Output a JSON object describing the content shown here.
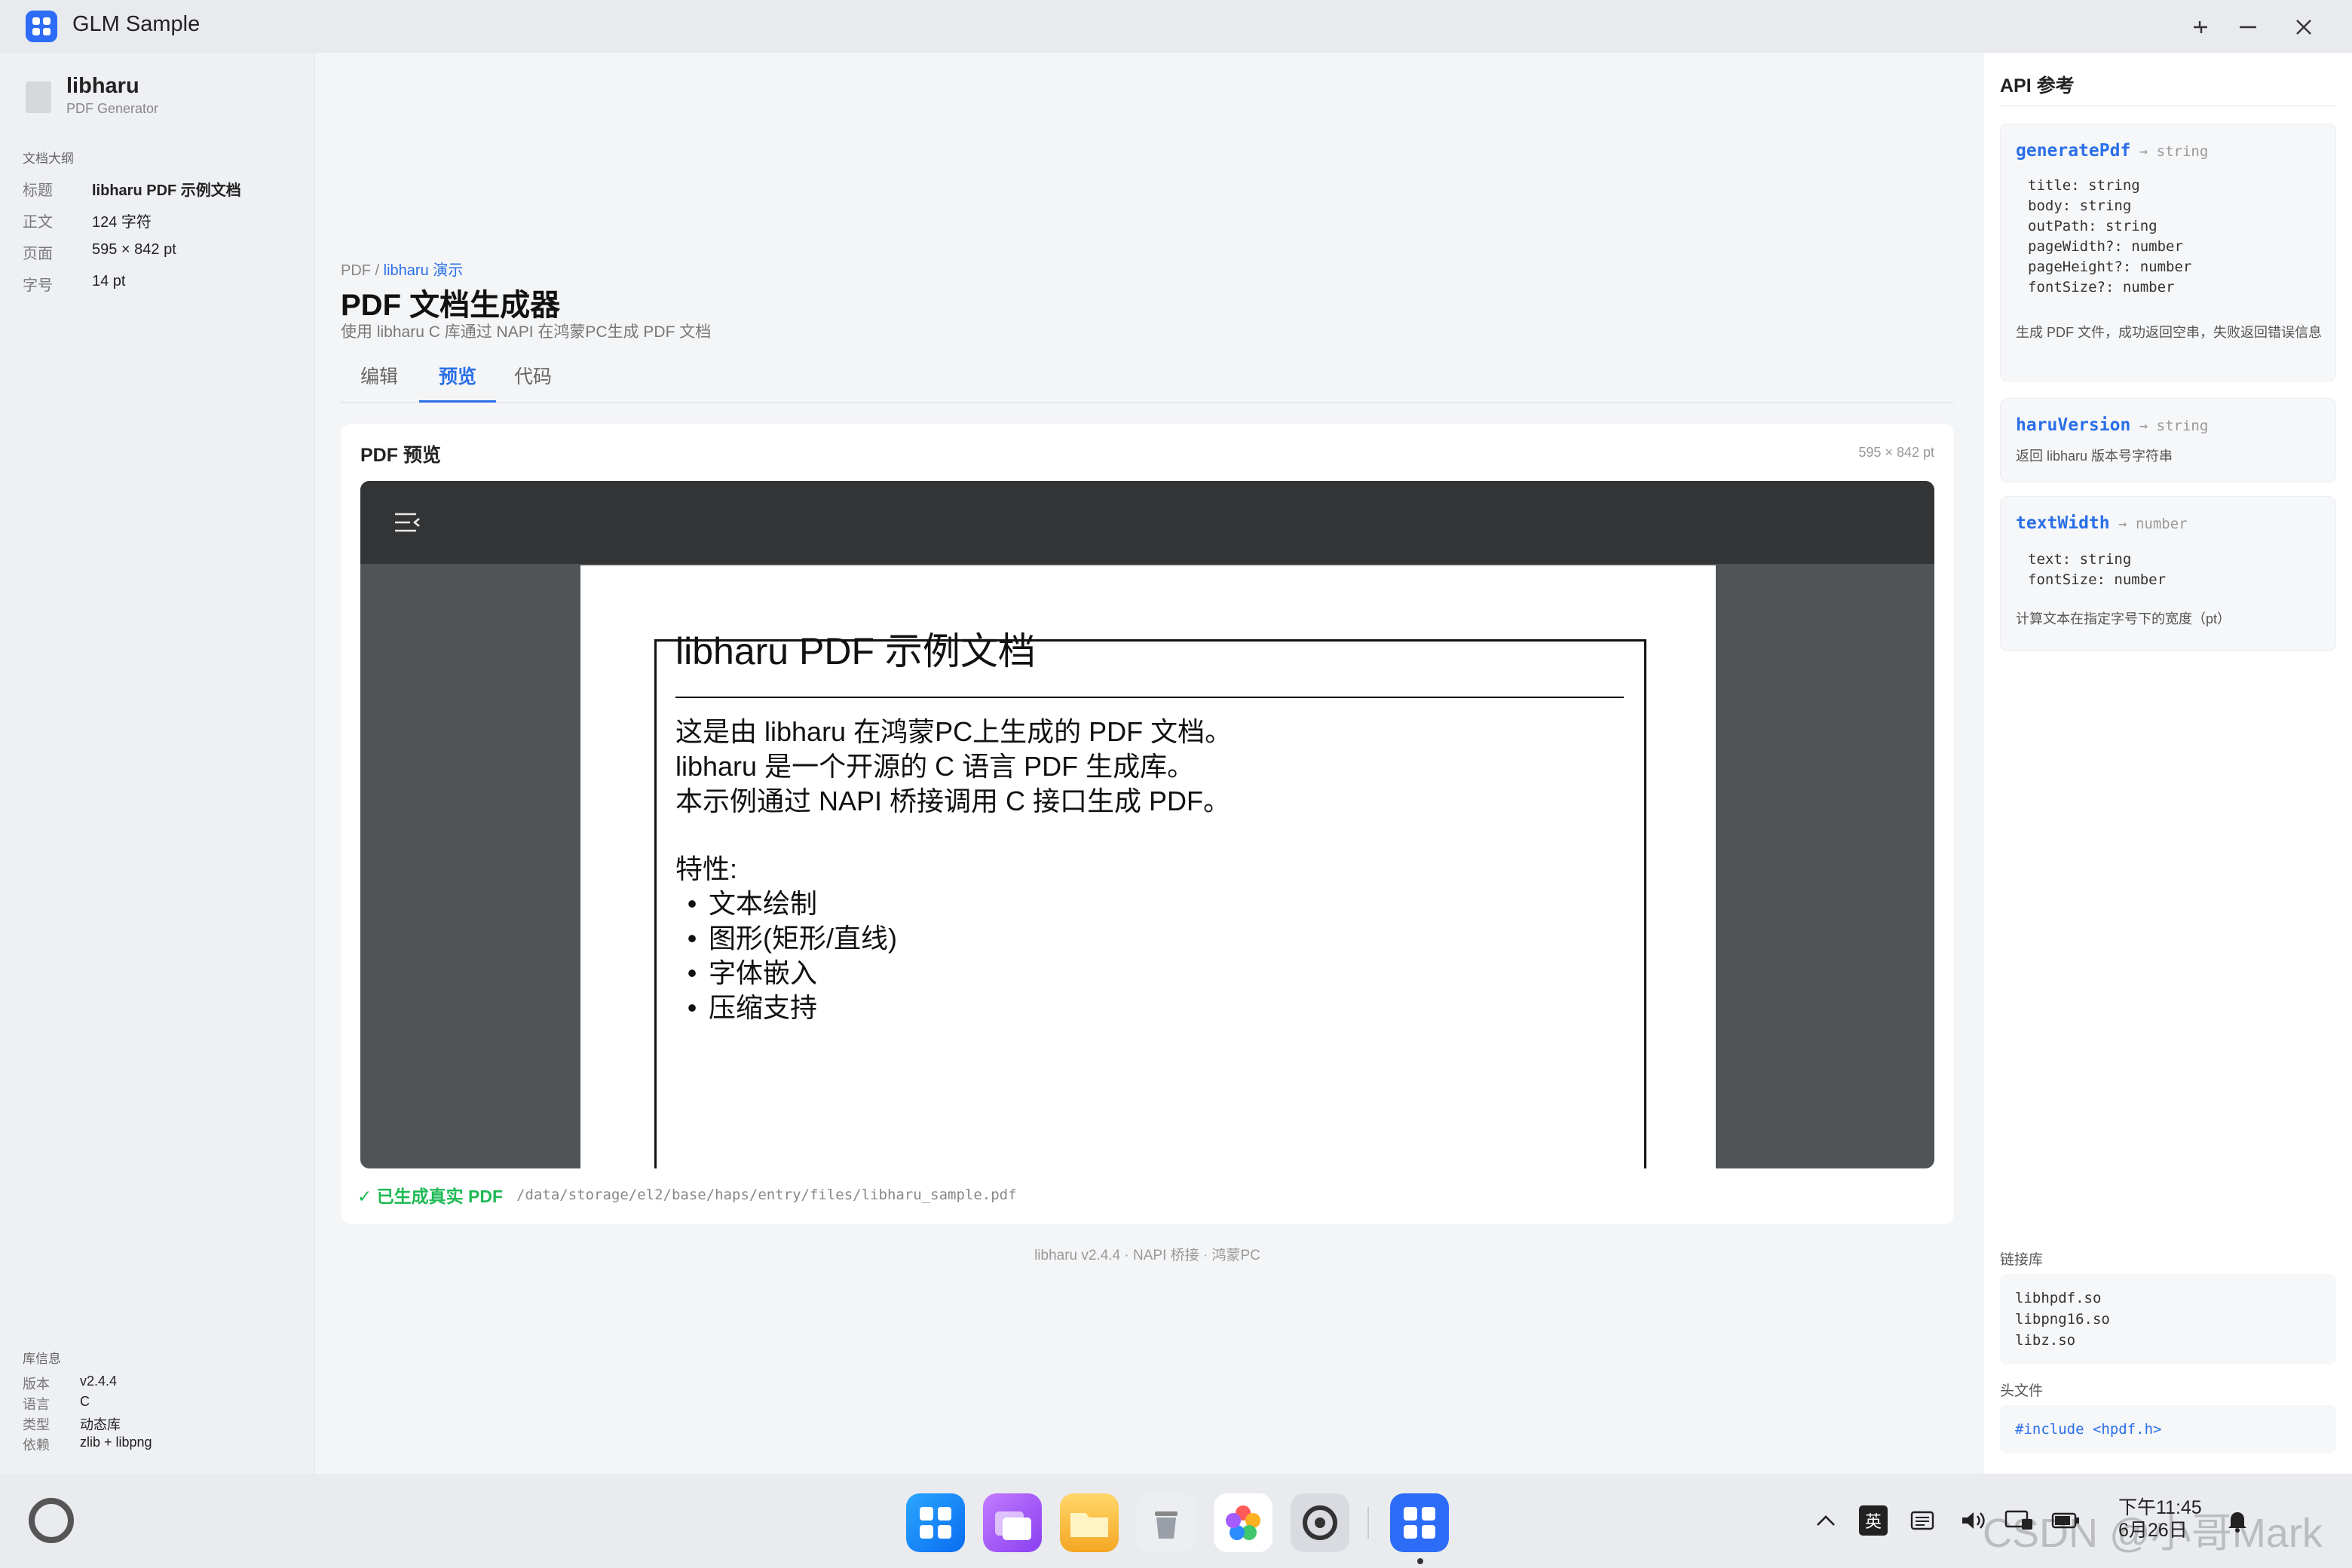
{
  "app": {
    "title": "GLM Sample"
  },
  "sidebar": {
    "lib_name": "libharu",
    "lib_subtitle": "PDF Generator",
    "outline_header": "文档大纲",
    "outline": [
      {
        "key": "标题",
        "value": "libharu PDF 示例文档"
      },
      {
        "key": "正文",
        "value": "124 字符"
      },
      {
        "key": "页面",
        "value": "595 × 842 pt"
      },
      {
        "key": "字号",
        "value": "14 pt"
      }
    ],
    "libinfo_header": "库信息",
    "libinfo": [
      {
        "key": "版本",
        "value": "v2.4.4"
      },
      {
        "key": "语言",
        "value": "C"
      },
      {
        "key": "类型",
        "value": "动态库"
      },
      {
        "key": "依赖",
        "value": "zlib + libpng"
      }
    ]
  },
  "main": {
    "breadcrumb": {
      "root": "PDF",
      "sep": " / ",
      "current": "libharu 演示"
    },
    "title": "PDF 文档生成器",
    "description": "使用 libharu C 库通过 NAPI 在鸿蒙PC生成 PDF 文档",
    "tabs": [
      {
        "label": "编辑",
        "active": false
      },
      {
        "label": "预览",
        "active": true
      },
      {
        "label": "代码",
        "active": false
      }
    ],
    "preview": {
      "title": "PDF 预览",
      "size": "595 × 842 pt",
      "pdf": {
        "heading": "libharu PDF 示例文档",
        "lines": [
          "这是由 libharu 在鸿蒙PC上生成的 PDF 文档。",
          "libharu 是一个开源的 C 语言 PDF 生成库。",
          "本示例通过 NAPI 桥接调用 C 接口生成 PDF。"
        ],
        "features_label": "特性:",
        "bullets": [
          "文本绘制",
          "图形(矩形/直线)",
          "字体嵌入",
          "压缩支持"
        ]
      },
      "status_ok": "✓ 已生成真实 PDF",
      "status_path": "/data/storage/el2/base/haps/entry/files/libharu_sample.pdf"
    },
    "footer": "libharu v2.4.4  ·  NAPI 桥接  ·  鸿蒙PC"
  },
  "api": {
    "title": "API 参考",
    "functions": [
      {
        "name": "generatePdf",
        "arrow": " → ",
        "returns": "string",
        "params": [
          "title: string",
          "body: string",
          "outPath: string",
          "pageWidth?: number",
          "pageHeight?: number",
          "fontSize?: number"
        ],
        "desc": "生成 PDF 文件，成功返回空串，失败返回错误信息"
      },
      {
        "name": "haruVersion",
        "arrow": " → ",
        "returns": "string",
        "params": [],
        "desc": "返回 libharu 版本号字符串"
      },
      {
        "name": "textWidth",
        "arrow": " → ",
        "returns": "number",
        "params": [
          "text: string",
          "fontSize: number"
        ],
        "desc": "计算文本在指定字号下的宽度（pt）"
      }
    ],
    "link_header": "链接库",
    "link_libs": [
      "libhpdf.so",
      "libpng16.so",
      "libz.so"
    ],
    "header_header": "头文件",
    "include": "#include <hpdf.h>"
  },
  "taskbar": {
    "ime": "英",
    "time": "下午11:45",
    "date": "6月26日",
    "watermark": "CSDN @小哥Mark"
  }
}
